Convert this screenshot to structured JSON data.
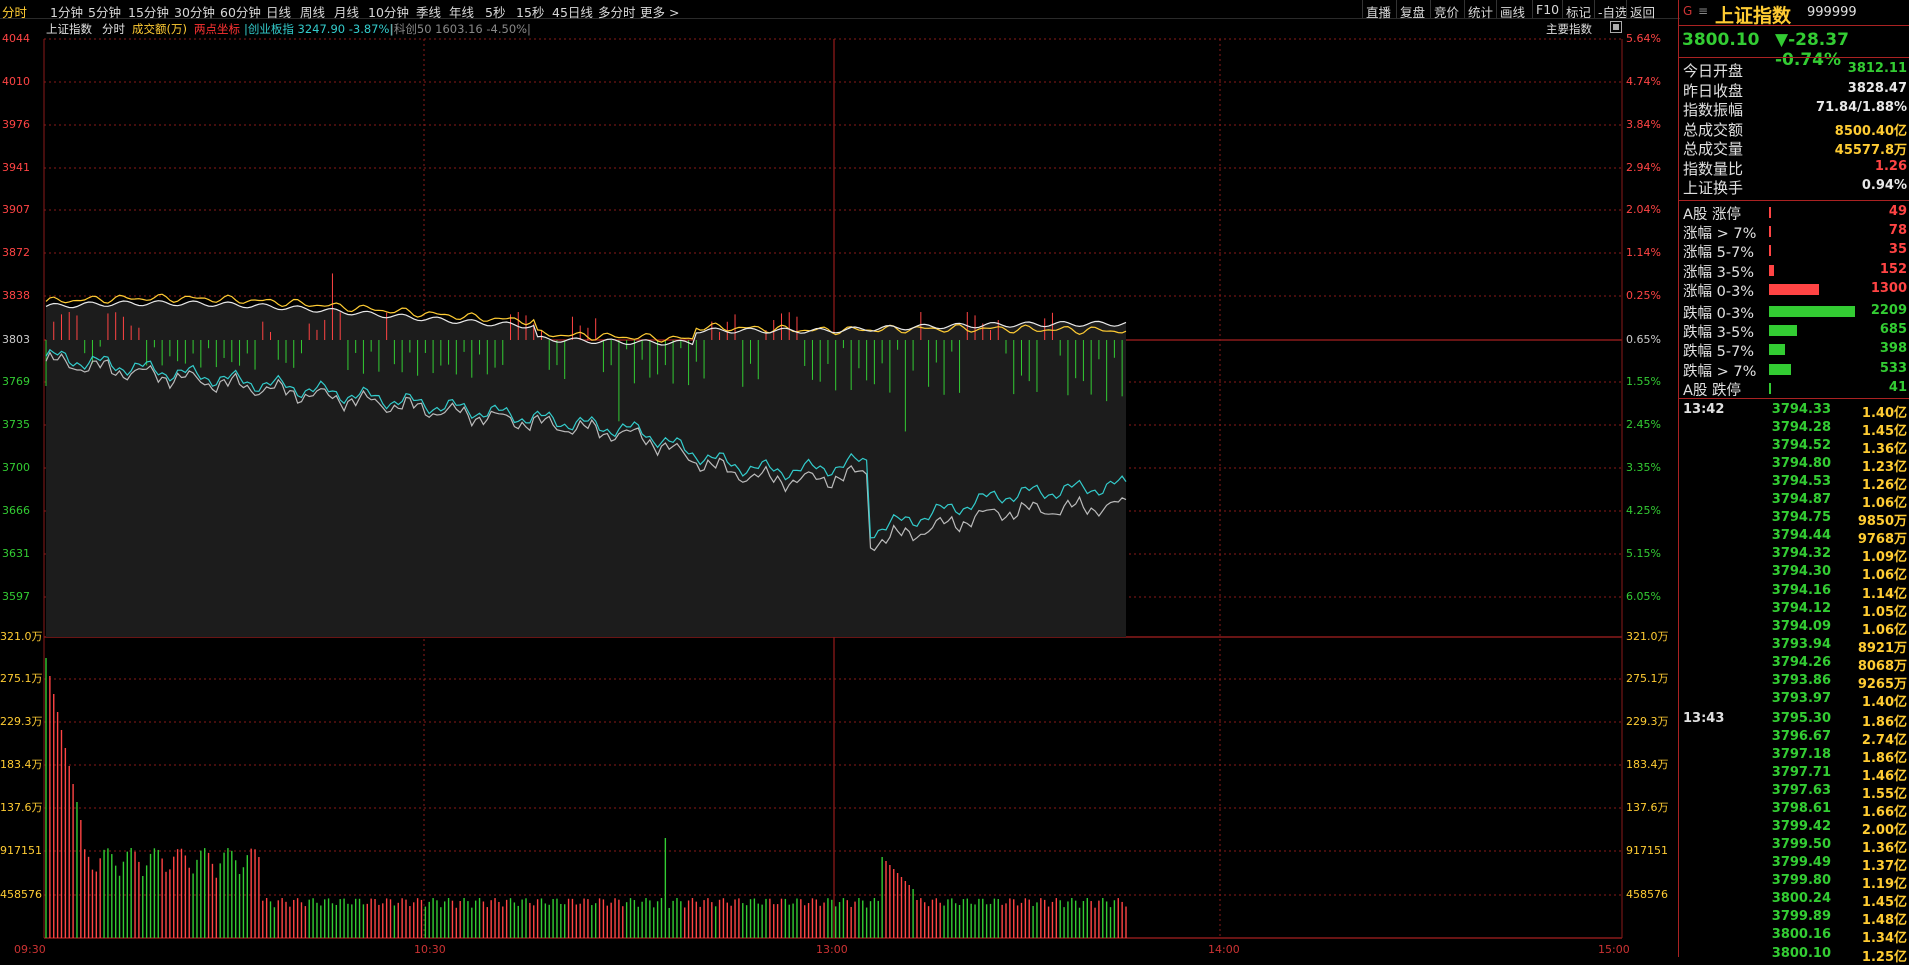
{
  "toolbar": {
    "periods": [
      "分时",
      "1分钟",
      "5分钟",
      "15分钟",
      "30分钟",
      "60分钟",
      "日线",
      "周线",
      "月线",
      "10分钟",
      "季线",
      "年线",
      "5秒",
      "15秒",
      "45日线",
      "多分时",
      "更多 >"
    ],
    "active_index": 0,
    "tools": [
      "直播",
      "复盘",
      "竞价",
      "统计",
      "画线",
      "F10",
      "标记",
      "-自选",
      "返回"
    ]
  },
  "legend": {
    "index_name": "上证指数",
    "mode": "分时",
    "volume_label": "成交额(万)",
    "crosshair_label": "两点坐标",
    "overlay1": "|创业板指 3247.90 -3.87%|",
    "overlay2": "|科创50 1603.16 -4.50%|",
    "main_indicator": "主要指数"
  },
  "axes": {
    "price_left": [
      "4044",
      "4010",
      "3976",
      "3941",
      "3907",
      "3872",
      "3838",
      "3803",
      "3769",
      "3735",
      "3700",
      "3666",
      "3631",
      "3597"
    ],
    "pct_right": [
      "5.64%",
      "4.74%",
      "3.84%",
      "2.94%",
      "2.04%",
      "1.14%",
      "0.25%",
      "0.65%",
      "1.55%",
      "2.45%",
      "3.35%",
      "4.25%",
      "5.15%",
      "6.05%"
    ],
    "vol_left": [
      "321.0万",
      "275.1万",
      "229.3万",
      "183.4万",
      "137.6万",
      "917151",
      "458576"
    ],
    "vol_right": [
      "321.0万",
      "275.1万",
      "229.3万",
      "183.4万",
      "137.6万",
      "917151",
      "458576"
    ],
    "times": [
      "09:30",
      "10:30",
      "13:00",
      "14:00",
      "15:00"
    ]
  },
  "colors": {
    "up": "#ff4444",
    "down": "#33cc33",
    "yellow": "#ffcc33",
    "cyan": "#33cccc",
    "grid": "#8a1a1a",
    "white": "#e8e8e8"
  },
  "right_panel": {
    "menu_icon": "menu-icon",
    "g": "G",
    "name": "上证指数",
    "code": "999999",
    "price": "3800.10",
    "change": "▼-28.37 -0.74%",
    "stats": [
      {
        "k": "今日开盘",
        "v": "3812.11",
        "c": "green"
      },
      {
        "k": "昨日收盘",
        "v": "3828.47",
        "c": "white"
      },
      {
        "k": "指数振幅",
        "v": "71.84/1.88%",
        "c": "white"
      },
      {
        "k": "总成交额",
        "v": "8500.40亿",
        "c": "yellow"
      },
      {
        "k": "总成交量",
        "v": "45577.8万",
        "c": "yellow"
      },
      {
        "k": "指数量比",
        "v": "1.26",
        "c": "red"
      },
      {
        "k": "上证换手",
        "v": "0.94%",
        "c": "white"
      }
    ],
    "breadth": [
      {
        "k": "A股 涨停",
        "v": "49",
        "c": "red",
        "w": 0.01
      },
      {
        "k": "涨幅 > 7%",
        "v": "78",
        "c": "red",
        "w": 0.02
      },
      {
        "k": "涨幅 5-7%",
        "v": "35",
        "c": "red",
        "w": 0.01
      },
      {
        "k": "涨幅 3-5%",
        "v": "152",
        "c": "red",
        "w": 0.04
      },
      {
        "k": "涨幅 0-3%",
        "v": "1300",
        "c": "red",
        "w": 0.42
      },
      {
        "k": "跌幅 0-3%",
        "v": "2209",
        "c": "green",
        "w": 0.72
      },
      {
        "k": "跌幅 3-5%",
        "v": "685",
        "c": "green",
        "w": 0.23
      },
      {
        "k": "跌幅 5-7%",
        "v": "398",
        "c": "green",
        "w": 0.13
      },
      {
        "k": "跌幅 > 7%",
        "v": "533",
        "c": "green",
        "w": 0.18
      },
      {
        "k": "A股 跌停",
        "v": "41",
        "c": "green",
        "w": 0.01
      }
    ],
    "ticks": [
      {
        "t": "13:42",
        "p": "3794.33",
        "a": "1.40亿"
      },
      {
        "t": "",
        "p": "3794.28",
        "a": "1.45亿"
      },
      {
        "t": "",
        "p": "3794.52",
        "a": "1.36亿"
      },
      {
        "t": "",
        "p": "3794.80",
        "a": "1.23亿"
      },
      {
        "t": "",
        "p": "3794.53",
        "a": "1.26亿"
      },
      {
        "t": "",
        "p": "3794.87",
        "a": "1.06亿"
      },
      {
        "t": "",
        "p": "3794.75",
        "a": "9850万"
      },
      {
        "t": "",
        "p": "3794.44",
        "a": "9768万"
      },
      {
        "t": "",
        "p": "3794.32",
        "a": "1.09亿"
      },
      {
        "t": "",
        "p": "3794.30",
        "a": "1.06亿"
      },
      {
        "t": "",
        "p": "3794.16",
        "a": "1.14亿"
      },
      {
        "t": "",
        "p": "3794.12",
        "a": "1.05亿"
      },
      {
        "t": "",
        "p": "3794.09",
        "a": "1.06亿"
      },
      {
        "t": "",
        "p": "3793.94",
        "a": "8921万"
      },
      {
        "t": "",
        "p": "3794.26",
        "a": "8068万"
      },
      {
        "t": "",
        "p": "3793.86",
        "a": "9265万"
      },
      {
        "t": "",
        "p": "3793.97",
        "a": "1.40亿"
      },
      {
        "t": "13:43",
        "p": "3795.30",
        "a": "1.86亿"
      },
      {
        "t": "",
        "p": "3796.67",
        "a": "2.74亿"
      },
      {
        "t": "",
        "p": "3797.18",
        "a": "1.86亿"
      },
      {
        "t": "",
        "p": "3797.71",
        "a": "1.46亿"
      },
      {
        "t": "",
        "p": "3797.63",
        "a": "1.55亿"
      },
      {
        "t": "",
        "p": "3798.61",
        "a": "1.66亿"
      },
      {
        "t": "",
        "p": "3799.42",
        "a": "2.00亿"
      },
      {
        "t": "",
        "p": "3799.50",
        "a": "1.36亿"
      },
      {
        "t": "",
        "p": "3799.49",
        "a": "1.37亿"
      },
      {
        "t": "",
        "p": "3799.80",
        "a": "1.19亿"
      },
      {
        "t": "",
        "p": "3800.24",
        "a": "1.45亿"
      },
      {
        "t": "",
        "p": "3799.89",
        "a": "1.48亿"
      },
      {
        "t": "",
        "p": "3800.16",
        "a": "1.34亿"
      },
      {
        "t": "",
        "p": "3800.10",
        "a": "1.25亿"
      }
    ]
  }
}
